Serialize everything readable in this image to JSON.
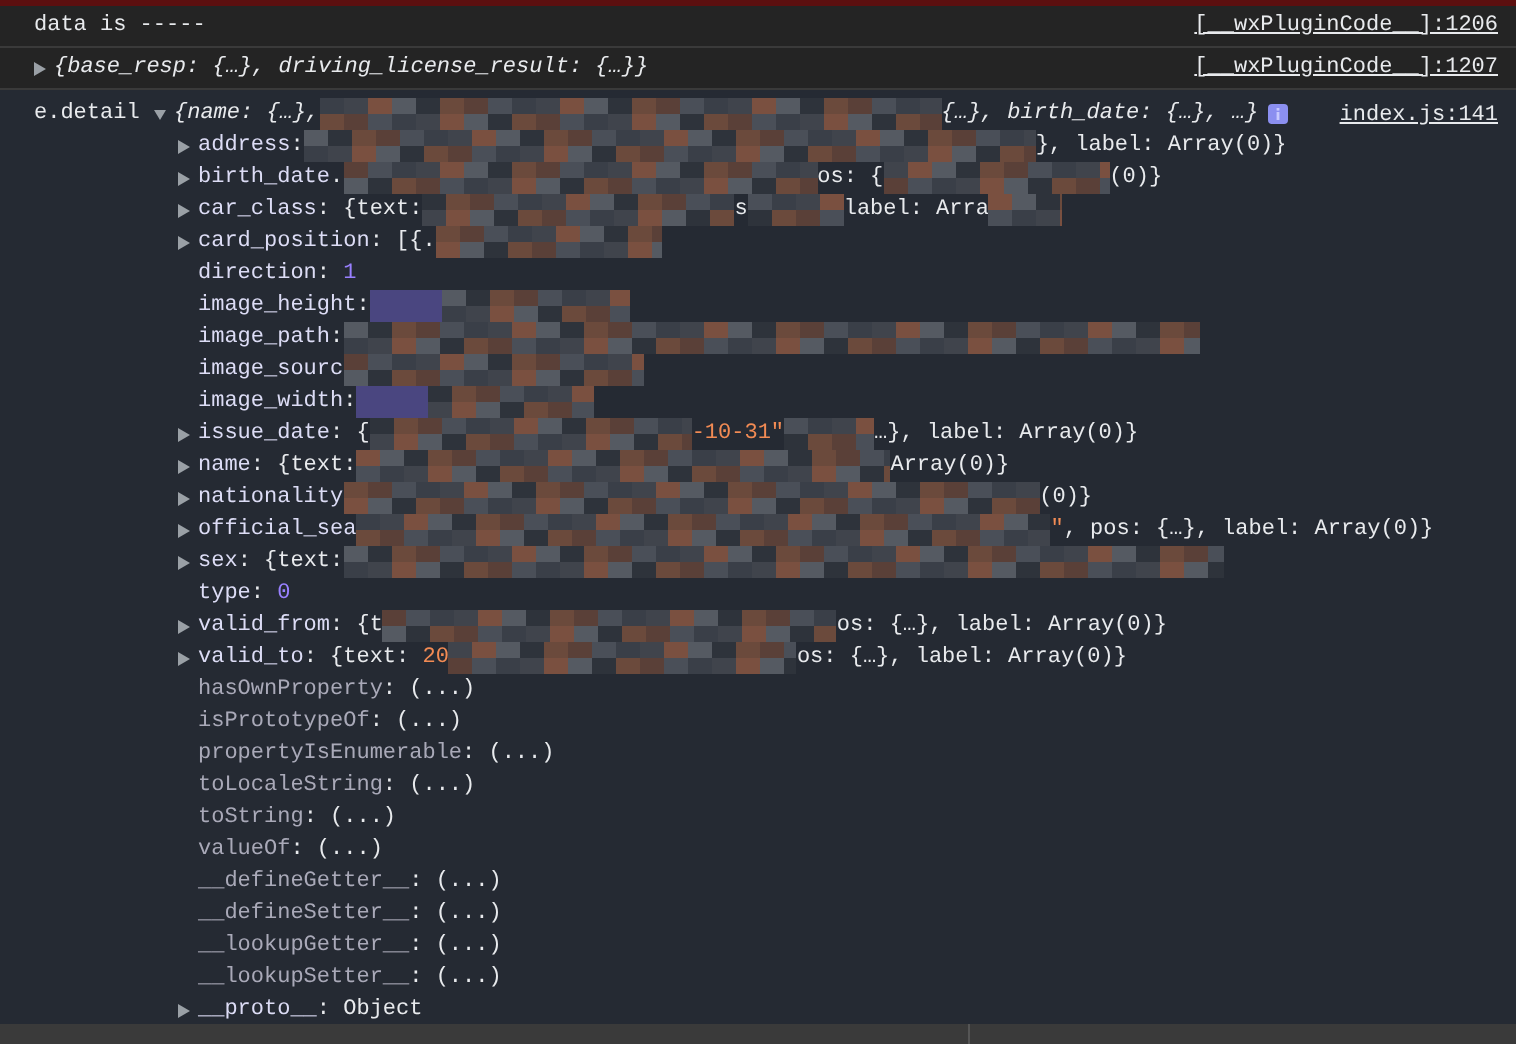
{
  "messages": [
    {
      "kind": "log",
      "text": "data is -----",
      "source": "[__wxPluginCode__]:1206"
    },
    {
      "kind": "object",
      "expanded": false,
      "text": "{base_resp: {…}, driving_license_result: {…}}",
      "source": "[__wxPluginCode__]:1207"
    }
  ],
  "detail": {
    "label": "e.detail",
    "expanded": true,
    "source": "index.js:141",
    "preview": [
      {
        "text": "{name: {…},",
        "kind": "text"
      },
      {
        "text": "{…}, birth_date: {…}, …}",
        "kind": "text"
      }
    ],
    "rows": [
      {
        "key": "address",
        "kind": "object",
        "fragments": [
          {
            "text": ":",
            "kind": "text"
          },
          {
            "text": "}, label: Array(0)}",
            "kind": "text"
          }
        ]
      },
      {
        "key": "birth_date",
        "kind": "object",
        "fragments": [
          {
            "text": ".",
            "kind": "text"
          },
          {
            "text": "os: {",
            "kind": "text"
          },
          {
            "text": "(0)}",
            "kind": "text"
          }
        ]
      },
      {
        "key": "car_class",
        "kind": "object",
        "fragments": [
          {
            "text": ": {text:",
            "kind": "text"
          },
          {
            "text": "s",
            "kind": "text"
          },
          {
            "text": "label: Arra",
            "kind": "text"
          }
        ]
      },
      {
        "key": "card_position",
        "kind": "object",
        "fragments": [
          {
            "text": ": [{.",
            "kind": "text"
          }
        ]
      },
      {
        "key": "direction",
        "kind": "primitive",
        "fragments": [
          {
            "text": ": ",
            "kind": "text"
          },
          {
            "text": "1",
            "kind": "number"
          }
        ]
      },
      {
        "key": "image_height",
        "kind": "primitive",
        "fragments": [
          {
            "text": ":",
            "kind": "text"
          }
        ]
      },
      {
        "key": "image_path",
        "kind": "primitive",
        "fragments": [
          {
            "text": ":",
            "kind": "text"
          }
        ]
      },
      {
        "key": "image_sourc",
        "kind": "primitive",
        "fragments": []
      },
      {
        "key": "image_width",
        "kind": "primitive",
        "fragments": [
          {
            "text": ":",
            "kind": "text"
          }
        ]
      },
      {
        "key": "issue_date",
        "kind": "object",
        "fragments": [
          {
            "text": ": {",
            "kind": "text"
          },
          {
            "text": "-10-31\"",
            "kind": "string"
          },
          {
            "text": "…}, label: Array(0)}",
            "kind": "text"
          }
        ]
      },
      {
        "key": "name",
        "kind": "object",
        "fragments": [
          {
            "text": ": {text:",
            "kind": "text"
          },
          {
            "text": "Array(0)}",
            "kind": "text"
          }
        ]
      },
      {
        "key": "nationality",
        "kind": "object",
        "fragments": [
          {
            "text": "(0)}",
            "kind": "text"
          }
        ]
      },
      {
        "key": "official_sea",
        "kind": "object",
        "fragments": [
          {
            "text": "\"",
            "kind": "string"
          },
          {
            "text": ", pos: {…}, label: Array(0)}",
            "kind": "text"
          }
        ]
      },
      {
        "key": "sex",
        "kind": "object",
        "fragments": [
          {
            "text": ": {text:",
            "kind": "text"
          }
        ]
      },
      {
        "key": "type",
        "kind": "primitive",
        "fragments": [
          {
            "text": ": ",
            "kind": "text"
          },
          {
            "text": "0",
            "kind": "number"
          }
        ]
      },
      {
        "key": "valid_from",
        "kind": "object",
        "fragments": [
          {
            "text": ": {t",
            "kind": "text"
          },
          {
            "text": "os: {…}, label: Array(0)}",
            "kind": "text"
          }
        ]
      },
      {
        "key": "valid_to",
        "kind": "object",
        "fragments": [
          {
            "text": ": {text: ",
            "kind": "text"
          },
          {
            "text": "20",
            "kind": "string"
          },
          {
            "text": "os: {…}, label: Array(0)}",
            "kind": "text"
          }
        ]
      },
      {
        "key": "hasOwnProperty",
        "kind": "inherited",
        "fragments": [
          {
            "text": ": (...)",
            "kind": "text"
          }
        ]
      },
      {
        "key": "isPrototypeOf",
        "kind": "inherited",
        "fragments": [
          {
            "text": ": (...)",
            "kind": "text"
          }
        ]
      },
      {
        "key": "propertyIsEnumerable",
        "kind": "inherited",
        "fragments": [
          {
            "text": ": (...)",
            "kind": "text"
          }
        ]
      },
      {
        "key": "toLocaleString",
        "kind": "inherited",
        "fragments": [
          {
            "text": ": (...)",
            "kind": "text"
          }
        ]
      },
      {
        "key": "toString",
        "kind": "inherited",
        "fragments": [
          {
            "text": ": (...)",
            "kind": "text"
          }
        ]
      },
      {
        "key": "valueOf",
        "kind": "inherited",
        "fragments": [
          {
            "text": ": (...)",
            "kind": "text"
          }
        ]
      },
      {
        "key": "__defineGetter__",
        "kind": "inherited",
        "fragments": [
          {
            "text": ": (...)",
            "kind": "text"
          }
        ]
      },
      {
        "key": "__defineSetter__",
        "kind": "inherited",
        "fragments": [
          {
            "text": ": (...)",
            "kind": "text"
          }
        ]
      },
      {
        "key": "__lookupGetter__",
        "kind": "inherited",
        "fragments": [
          {
            "text": ": (...)",
            "kind": "text"
          }
        ]
      },
      {
        "key": "__lookupSetter__",
        "kind": "inherited",
        "fragments": [
          {
            "text": ": (...)",
            "kind": "text"
          }
        ]
      },
      {
        "key": "__proto__",
        "kind": "object",
        "fragments": [
          {
            "text": ": ",
            "kind": "text"
          },
          {
            "text": "Object",
            "kind": "text"
          }
        ]
      }
    ]
  }
}
